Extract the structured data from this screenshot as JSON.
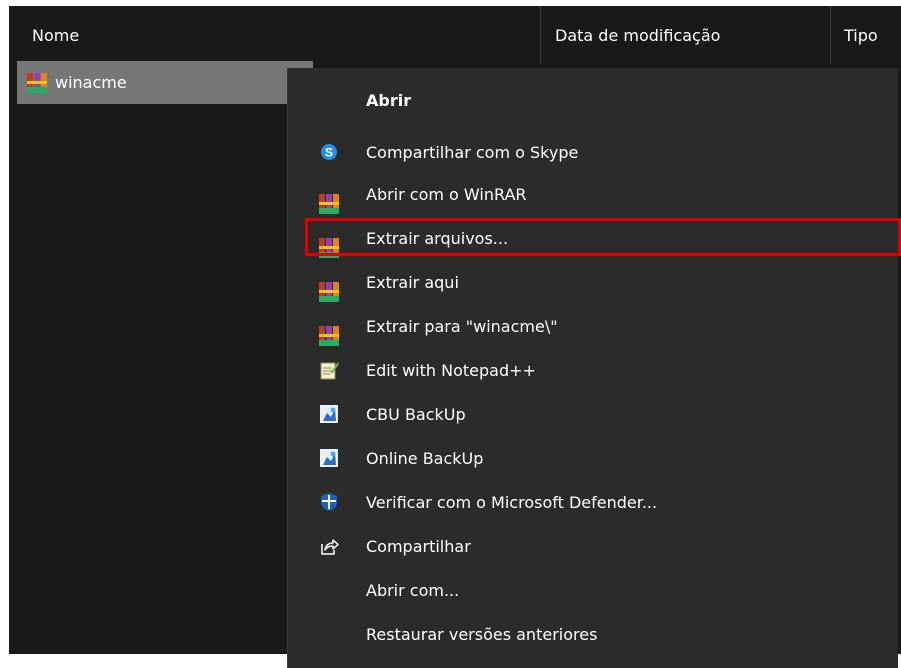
{
  "columns": {
    "name": "Nome",
    "date": "Data de modificação",
    "type": "Tipo"
  },
  "sort_indicator": "^",
  "file": {
    "name": "winacme",
    "icon": "winrar-archive-icon"
  },
  "context_menu": {
    "items": [
      {
        "label": "Abrir",
        "icon": "",
        "bold": true
      },
      {
        "label": "Compartilhar com o Skype",
        "icon": "skype-icon"
      },
      {
        "label": "Abrir com o WinRAR",
        "icon": "winrar-icon"
      },
      {
        "label": "Extrair arquivos...",
        "icon": "winrar-icon",
        "highlighted": true
      },
      {
        "label": "Extrair aqui",
        "icon": "winrar-icon"
      },
      {
        "label": "Extrair para \"winacme\\\"",
        "icon": "winrar-icon"
      },
      {
        "label": "Edit with Notepad++",
        "icon": "notepad-plus-plus-icon"
      },
      {
        "label": "CBU BackUp",
        "icon": "backup-icon"
      },
      {
        "label": "Online BackUp",
        "icon": "backup-icon"
      },
      {
        "label": "Verificar com o Microsoft Defender...",
        "icon": "defender-shield-icon"
      },
      {
        "label": "Compartilhar",
        "icon": "share-icon"
      },
      {
        "label": "Abrir com...",
        "icon": ""
      },
      {
        "label": "Restaurar versões anteriores",
        "icon": ""
      }
    ]
  },
  "colors": {
    "background": "#191919",
    "menu_background": "#2b2b2b",
    "selection": "#777777",
    "highlight_border": "#e00000",
    "skype": "#1e90e8",
    "defender": "#1565c0"
  }
}
